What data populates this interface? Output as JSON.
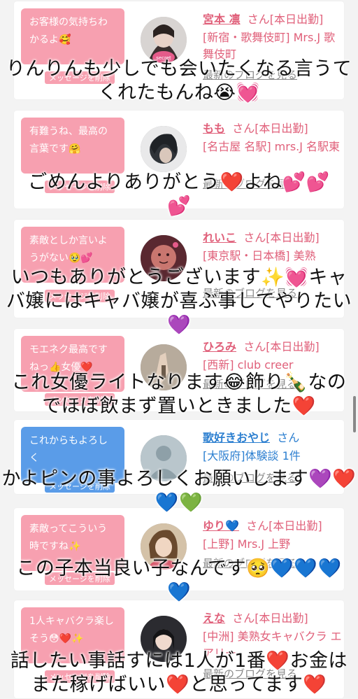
{
  "cards": [
    {
      "bubble": "お客様の気持ちわかるよ🥰",
      "bubble_color": "pink",
      "delete_label": "メッセージを削除",
      "name": "宮本 凛",
      "suffix": "さん[本日出勤]",
      "shop": "[新宿・歌舞伎町] Mrs.J 歌舞伎町",
      "blog": "最新のブログを見る",
      "avatar_label": "secret"
    },
    {
      "bubble": "有難うね、最高の言葉です🤗",
      "bubble_color": "pink",
      "delete_label": "メッセージを削除",
      "name": "もも",
      "suffix": "さん[本日出勤]",
      "shop": "[名古屋 名駅] mrs.J 名駅東",
      "blog": "最新のブログを見る"
    },
    {
      "bubble": "素敵としか言いようがない🥹💕",
      "bubble_color": "pink",
      "delete_label": "メッセージを削除",
      "name": "れいこ",
      "suffix": "さん[本日出勤]",
      "shop": "[東京駅・日本橋] 美熟",
      "blog": "最新のブログを見る"
    },
    {
      "bubble": "モエネク最高ですねっ👍女優❤️",
      "bubble_color": "pink",
      "delete_label": "メッセージを削除",
      "name": "ひろみ",
      "suffix": "さん[本日出勤]",
      "shop": "[西新] club creer",
      "blog": "最新のブログを見る"
    },
    {
      "bubble": "これからもよろしく",
      "bubble_color": "blue",
      "delete_label": "メッセージを削除",
      "name": "歌好きおやじ",
      "suffix": "さん",
      "shop": "[大阪府]体験談 1件",
      "blog": "最新のブログを見る"
    },
    {
      "bubble": "素敵ってこういう時ですね✨",
      "bubble_color": "pink",
      "delete_label": "メッセージを削除",
      "name": "ゆり💙",
      "suffix": "さん[本日出勤]",
      "shop": "[上野] Mrs.J 上野",
      "blog": "最新のブログを見る"
    },
    {
      "bubble": "1人キャバクラ楽しそう😳❤️✨",
      "bubble_color": "pink",
      "delete_label": "メッセージを削除",
      "name": "えな",
      "suffix": "さん[本日出勤]",
      "shop": "[中洲] 美熟女キャバクラ エアリー",
      "blog": "最新のブログを見る"
    }
  ],
  "captions": [
    "りんりんも少しでも会いたくなる言うてくれたもんね😭💓",
    "ごめんよりありがとう❤️よね💕💕💕",
    "いつもありがとうございます✨💓キャバ嬢にはキャバ嬢が喜ぶ事してやりたい💜",
    "これ女優ライトなります😂飾り🍾なのでほぼ飲まず置いときました❤️",
    "かよピンの事よろしくお願いします💜❤️💙💚",
    "この子本当良い子なんです🥺💙💙💙💙",
    "話したい事話すには1人が1番❤️お金はまた稼げばいい❤️と思ってます❤️"
  ],
  "colors": {
    "pink_bubble": "#f7a0b0",
    "blue_bubble": "#5a9ce8",
    "pink_text": "#e0607a",
    "blue_text": "#2c7fd0"
  }
}
